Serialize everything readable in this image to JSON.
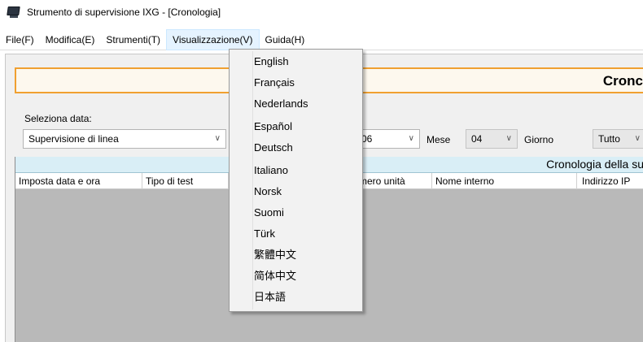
{
  "window": {
    "title": "Strumento di supervisione IXG - [Cronologia]",
    "icon": "monitor-icon"
  },
  "menubar": {
    "items": [
      {
        "label": "File(F)"
      },
      {
        "label": "Modifica(E)"
      },
      {
        "label": "Strumenti(T)"
      },
      {
        "label": "Visualizzazione(V)",
        "open": true
      },
      {
        "label": "Guida(H)"
      }
    ]
  },
  "header": {
    "title": "Cronc"
  },
  "filters": {
    "select_label": "Seleziona data:",
    "mode_value": "Supervisione di linea",
    "year_partial": "06",
    "month_label": "Mese",
    "month_value": "04",
    "day_label": "Giorno",
    "day_value": "Tutto"
  },
  "grid": {
    "caption": "Cronologia della su",
    "columns": [
      "Imposta data e ora",
      "Tipo di test",
      "mero unità",
      "Nome interno",
      "Indirizzo IP"
    ]
  },
  "language_menu": {
    "items": [
      "English",
      "Français",
      "Nederlands",
      "Español",
      "Deutsch",
      "Italiano",
      "Norsk",
      "Suomi",
      "Türk",
      "繁體中文",
      "简体中文",
      "日本語"
    ]
  },
  "colors": {
    "accent_orange": "#f0a030",
    "menu_highlight": "#e5f3ff",
    "caption_bar": "#d9eef6",
    "grid_bg": "#b9b9b9"
  }
}
